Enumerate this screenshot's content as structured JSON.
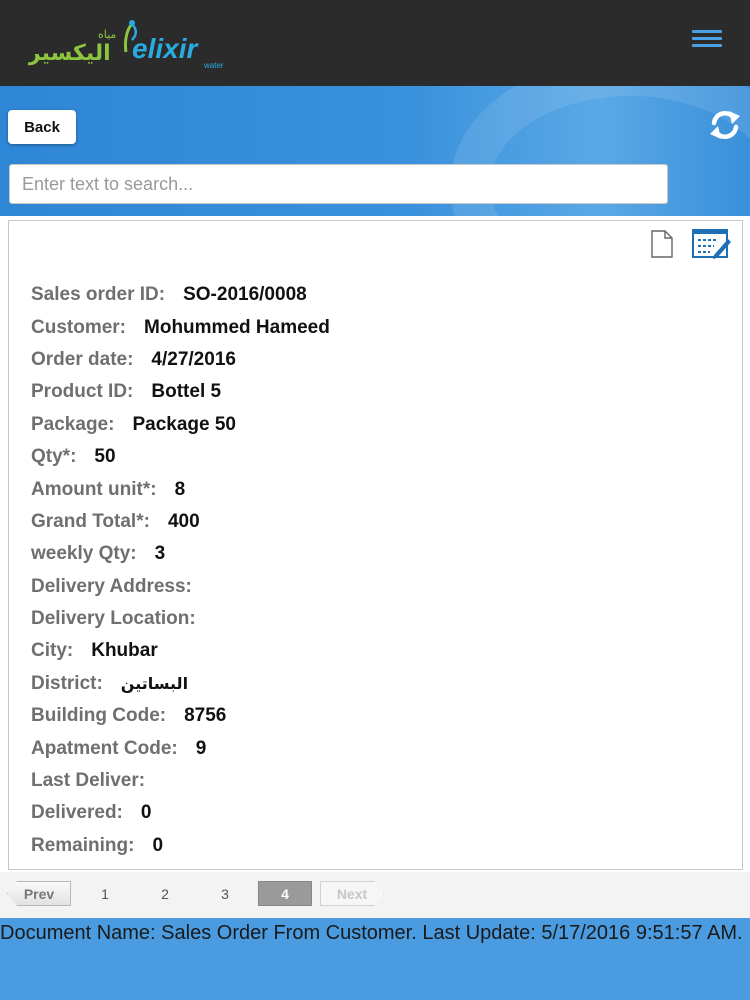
{
  "header": {
    "logo_arabic": "اليكسير",
    "logo_arabic_small": "مياه",
    "logo_brand": "elixir",
    "logo_sub": "water"
  },
  "toolbar": {
    "back_label": "Back"
  },
  "search": {
    "placeholder": "Enter text to search..."
  },
  "record": {
    "fields": [
      {
        "label": "Sales order ID:",
        "value": "SO-2016/0008"
      },
      {
        "label": "Customer:",
        "value": "Mohummed Hameed"
      },
      {
        "label": "Order date:",
        "value": "4/27/2016"
      },
      {
        "label": "Product ID:",
        "value": "Bottel 5"
      },
      {
        "label": "Package:",
        "value": "Package 50"
      },
      {
        "label": "Qty*:",
        "value": "50"
      },
      {
        "label": "Amount unit*:",
        "value": "8"
      },
      {
        "label": "Grand Total*:",
        "value": "400"
      },
      {
        "label": "weekly Qty:",
        "value": "3"
      },
      {
        "label": "Delivery Address:",
        "value": ""
      },
      {
        "label": "Delivery Location:",
        "value": ""
      },
      {
        "label": "City:",
        "value": "Khubar"
      },
      {
        "label": "District:",
        "value": "البساتين"
      },
      {
        "label": "Building Code:",
        "value": "8756"
      },
      {
        "label": "Apatment Code:",
        "value": "9"
      },
      {
        "label": "Last Deliver:",
        "value": ""
      },
      {
        "label": "Delivered:",
        "value": "0"
      },
      {
        "label": "Remaining:",
        "value": "0"
      }
    ]
  },
  "pager": {
    "prev_label": "Prev",
    "pages": [
      "1",
      "2",
      "3"
    ],
    "current": "4",
    "next_label": "Next"
  },
  "footer": {
    "text": "Document Name: Sales Order From Customer. Last Update: 5/17/2016 9:51:57 AM."
  }
}
